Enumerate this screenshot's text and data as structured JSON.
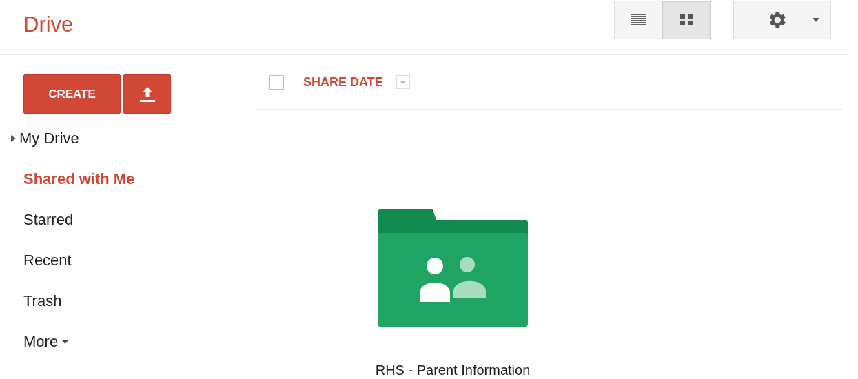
{
  "app": {
    "title": "Drive"
  },
  "view_buttons": [
    {
      "kind": "list",
      "selected": false
    },
    {
      "kind": "grid",
      "selected": true
    }
  ],
  "sidebar": {
    "create_label": "CREATE",
    "items": [
      {
        "label": "My Drive",
        "kind": "expandable",
        "selected": false
      },
      {
        "label": "Shared with Me",
        "kind": "plain",
        "selected": true
      },
      {
        "label": "Starred",
        "kind": "plain",
        "selected": false
      },
      {
        "label": "Recent",
        "kind": "plain",
        "selected": false
      },
      {
        "label": "Trash",
        "kind": "plain",
        "selected": false
      },
      {
        "label": "More",
        "kind": "menu",
        "selected": false
      }
    ]
  },
  "list_header": {
    "select_all_checked": false,
    "sort_label": "SHARE DATE"
  },
  "files": [
    {
      "name": "RHS - Parent Information",
      "kind": "shared_folder"
    }
  ]
}
